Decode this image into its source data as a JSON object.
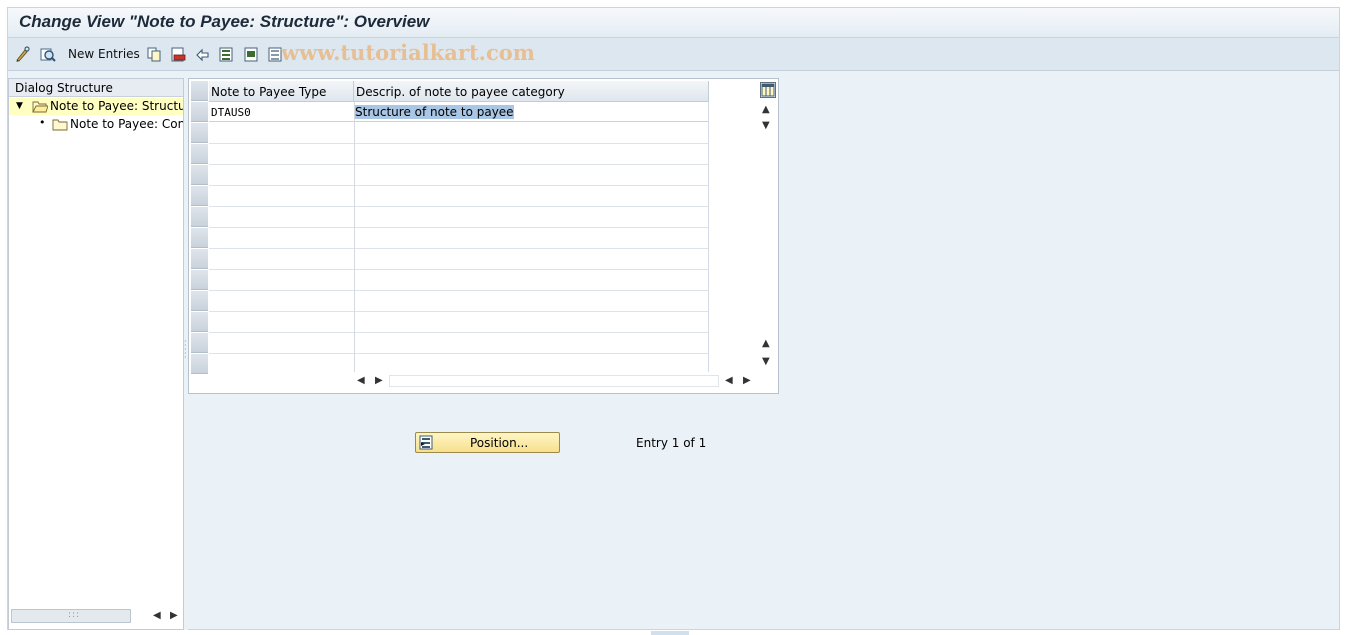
{
  "window": {
    "title": "Change View \"Note to Payee: Structure\": Overview"
  },
  "toolbar": {
    "new_entries_label": "New Entries",
    "watermark": "www.tutorialkart.com",
    "icons": [
      "display-change-icon",
      "details-icon",
      "copy-icon",
      "delete-icon",
      "undo-icon",
      "select-all-icon",
      "select-block-icon",
      "deselect-all-icon"
    ]
  },
  "dialog_structure": {
    "header": "Dialog Structure",
    "items": [
      {
        "label": "Note to Payee: Structur",
        "selected": true,
        "expanded": true
      },
      {
        "label": "Note to Payee: Cont",
        "selected": false
      }
    ]
  },
  "table": {
    "columns": [
      "Note to Payee Type",
      "Descrip. of note to payee category"
    ],
    "rows": [
      {
        "type": "DTAUS0",
        "description": "Structure of note to payee"
      }
    ]
  },
  "footer": {
    "position_button_label": "Position...",
    "entry_text": "Entry 1 of 1"
  },
  "colors": {
    "background": "#eaf1f7",
    "selected_tree_item": "#ffffc2",
    "position_button": "#f7df8c",
    "cell_highlight": "#a9c6e5"
  }
}
